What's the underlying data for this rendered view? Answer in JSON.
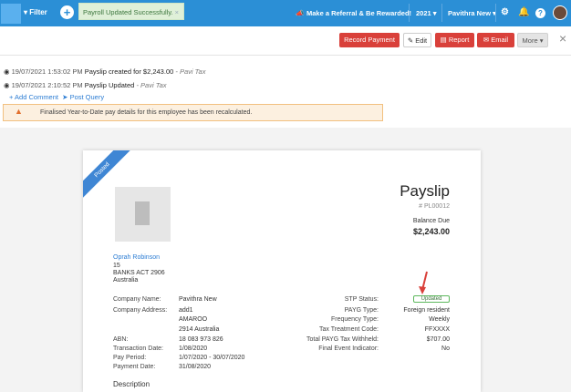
{
  "topbar": {
    "filter": "▾ Filter",
    "toast": "Payroll Updated Successfully.",
    "refer": "Make a Referral & Be Rewarded!",
    "year": "2021 ▾",
    "company": "Pavithra New ▾"
  },
  "actions": {
    "record": "Record Payment",
    "edit": "✎ Edit",
    "report": "Report",
    "email": "Email",
    "more": "More ▾"
  },
  "log": [
    {
      "time": "19/07/2021 1:53:02 PM",
      "msg": "Payslip created for $2,243.00",
      "by": "- Pavi Tax"
    },
    {
      "time": "19/07/2021 2:10:52 PM",
      "msg": "Payslip Updated",
      "by": "- Pavi Tax"
    }
  ],
  "links": {
    "comment": "+ Add Comment",
    "query": "Post Query"
  },
  "alert": "Finalised Year-to-Date pay details for this employee has been recalculated.",
  "payslip": {
    "ribbon": "Posted",
    "title": "Payslip",
    "number": "# PL00012",
    "balance_label": "Balance Due",
    "balance": "$2,243.00",
    "address": [
      "Oprah Robinson",
      "15",
      "BANKS ACT 2906",
      "Australia"
    ],
    "left": [
      {
        "k": "Company Name:",
        "v": "Pavithra New"
      },
      {
        "k": "Company Address:",
        "v": "add1"
      },
      {
        "k": "",
        "v": "AMAROO"
      },
      {
        "k": "",
        "v": "2914 Australia"
      },
      {
        "k": "ABN:",
        "v": "18 083 973 826"
      },
      {
        "k": "Transaction Date:",
        "v": "1/08/2020"
      },
      {
        "k": "Pay Period:",
        "v": "1/07/2020 - 30/07/2020"
      },
      {
        "k": "Payment Date:",
        "v": "31/08/2020"
      }
    ],
    "right": [
      {
        "k": "STP Status:",
        "v": "Updated"
      },
      {
        "k": "PAYG Type:",
        "v": "Foreign resident"
      },
      {
        "k": "Frequency Type:",
        "v": "Weekly"
      },
      {
        "k": "Tax Treatment Code:",
        "v": "FFXXXX"
      },
      {
        "k": "Total PAYG Tax Withheld:",
        "v": "$707.00"
      },
      {
        "k": "Final Event Indicator:",
        "v": "No"
      }
    ],
    "description": "Description"
  }
}
